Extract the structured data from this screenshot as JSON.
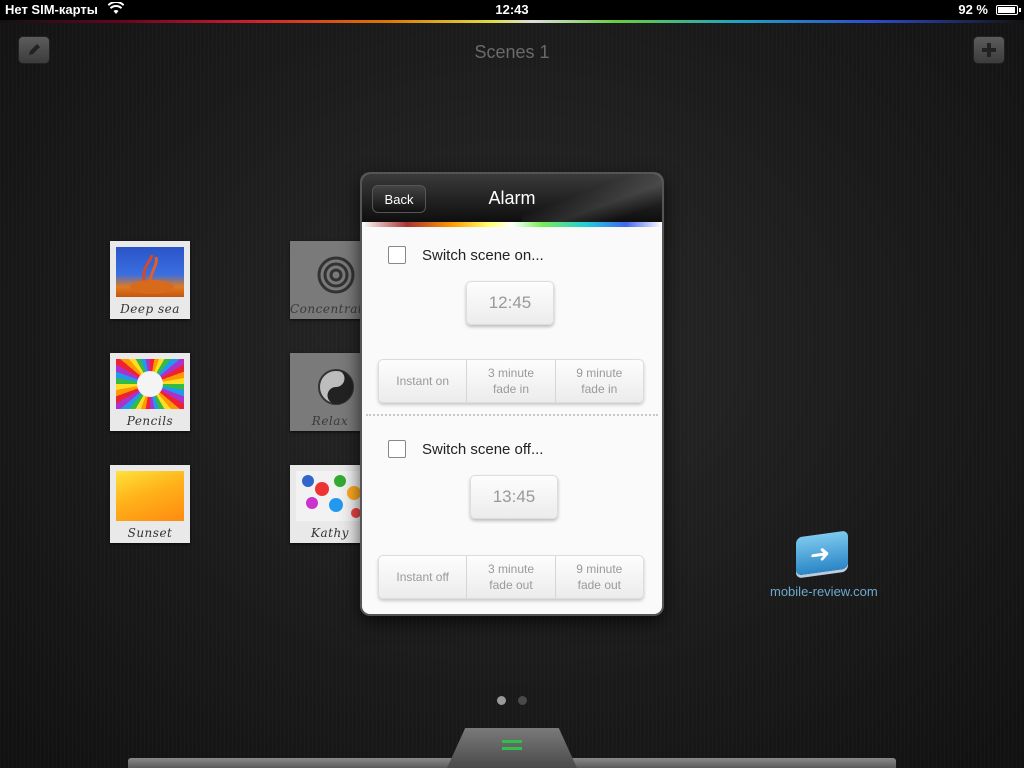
{
  "status_bar": {
    "carrier": "Нет SIM-карты",
    "time": "12:43",
    "battery": "92 %"
  },
  "header": {
    "title": "Scenes 1",
    "edit_icon": "pencil-icon",
    "add_icon": "plus-icon"
  },
  "scenes": [
    {
      "label": "Deep sea"
    },
    {
      "label": "Concentrate"
    },
    {
      "label": "Pencils"
    },
    {
      "label": "Relax"
    },
    {
      "label": "Sunset"
    },
    {
      "label": "Kathy"
    }
  ],
  "modal": {
    "back_label": "Back",
    "title": "Alarm",
    "on": {
      "label": "Switch scene on...",
      "time": "12:45",
      "options": [
        "Instant on",
        "3 minute\nfade in",
        "9 minute\nfade in"
      ]
    },
    "off": {
      "label": "Switch scene off...",
      "time": "13:45",
      "options": [
        "Instant off",
        "3 minute\nfade out",
        "9 minute\nfade out"
      ]
    }
  },
  "watermark": {
    "text": "mobile-review.com"
  },
  "pager": {
    "pages": 2,
    "current": 1
  },
  "colors": {
    "accent_green": "#2fbf4a",
    "modal_header": "#0c0c0c"
  }
}
